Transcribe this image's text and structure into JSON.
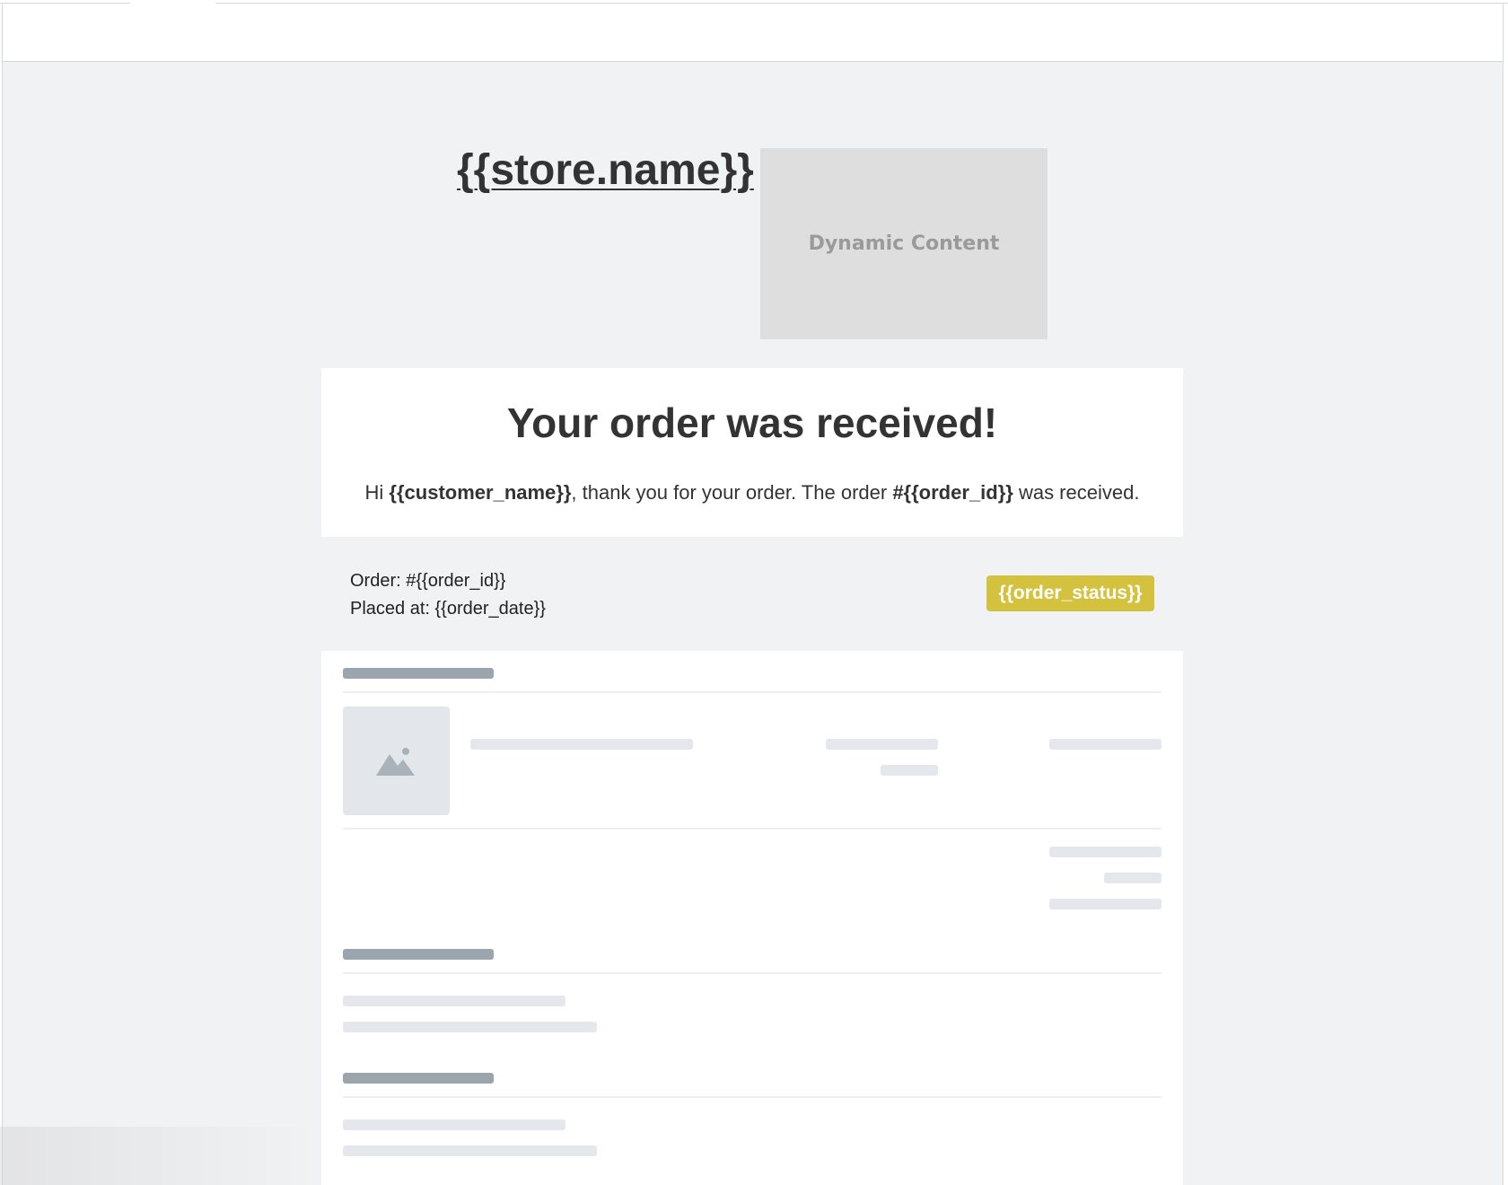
{
  "header": {
    "store_name": "{{store.name}}",
    "dynamic_content_label": "Dynamic Content"
  },
  "hero": {
    "title": "Your order was received!",
    "text_prefix": "Hi ",
    "customer_name": "{{customer_name}}",
    "text_middle": ", thank you for your order. The order ",
    "order_ref": "#{{order_id}}",
    "text_suffix": " was received."
  },
  "order_info": {
    "order_line": "Order: #{{order_id}}",
    "placed_line": "Placed at: {{order_date}}",
    "status": "{{order_status}}"
  },
  "colors": {
    "canvas_bg": "#f1f2f4",
    "status_badge": "#d4c23f",
    "skeleton_dark": "#9ba5ae",
    "skeleton_light": "#e4e8ec"
  },
  "icons": {
    "product_image_placeholder": "image-placeholder-icon"
  }
}
